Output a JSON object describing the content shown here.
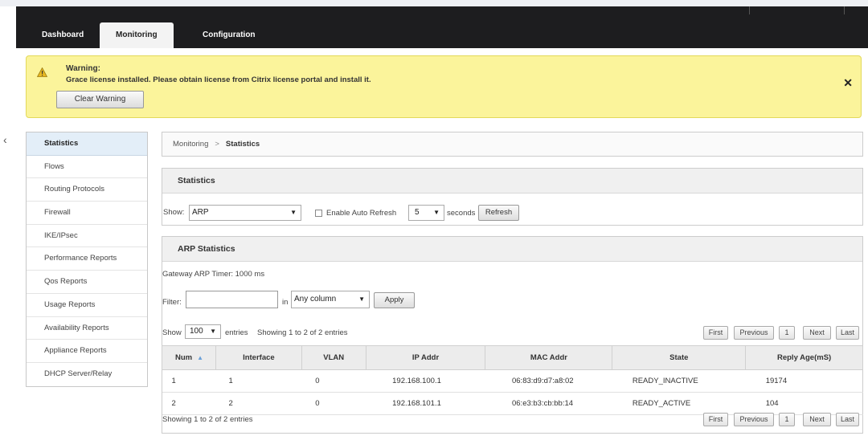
{
  "nav": {
    "tabs": [
      {
        "label": "Dashboard",
        "active": false
      },
      {
        "label": "Monitoring",
        "active": true
      },
      {
        "label": "Configuration",
        "active": false
      }
    ]
  },
  "warning": {
    "title": "Warning:",
    "message": "Grace license installed. Please obtain license from Citrix license portal and install it.",
    "clear_label": "Clear Warning",
    "close_glyph": "✕",
    "icon": "warning-triangle-icon",
    "background": "#fbf49b"
  },
  "collapse_glyph": "‹",
  "sidebar": {
    "items": [
      {
        "label": "Statistics",
        "active": true
      },
      {
        "label": "Flows",
        "active": false
      },
      {
        "label": "Routing Protocols",
        "active": false
      },
      {
        "label": "Firewall",
        "active": false
      },
      {
        "label": "IKE/IPsec",
        "active": false
      },
      {
        "label": "Performance Reports",
        "active": false
      },
      {
        "label": "Qos Reports",
        "active": false
      },
      {
        "label": "Usage Reports",
        "active": false
      },
      {
        "label": "Availability Reports",
        "active": false
      },
      {
        "label": "Appliance Reports",
        "active": false
      },
      {
        "label": "DHCP Server/Relay",
        "active": false
      }
    ]
  },
  "breadcrumb": {
    "parent": "Monitoring",
    "separator": ">",
    "current": "Statistics"
  },
  "statistics": {
    "title": "Statistics",
    "show_label": "Show:",
    "show_value": "ARP",
    "auto_refresh_label": "Enable Auto Refresh",
    "auto_refresh_checked": false,
    "interval_value": "5",
    "seconds_label": "seconds",
    "refresh_label": "Refresh"
  },
  "arp": {
    "title": "ARP Statistics",
    "timer_text": "Gateway ARP Timer: 1000 ms",
    "filter_label": "Filter:",
    "filter_value": "",
    "in_label": "in",
    "column_value": "Any column",
    "apply_label": "Apply",
    "show_label": "Show",
    "entries_value": "100",
    "entries_label": "entries",
    "showing_text": "Showing 1 to 2 of 2 entries",
    "pagination": {
      "first": "First",
      "previous": "Previous",
      "page": "1",
      "next": "Next",
      "last": "Last"
    },
    "columns": [
      "Num",
      "Interface",
      "VLAN",
      "IP Addr",
      "MAC Addr",
      "State",
      "Reply Age(mS)"
    ],
    "rows": [
      [
        "1",
        "1",
        "0",
        "192.168.100.1",
        "06:83:d9:d7:a8:02",
        "READY_INACTIVE",
        "19174"
      ],
      [
        "2",
        "2",
        "0",
        "192.168.101.1",
        "06:e3:b3:cb:bb:14",
        "READY_ACTIVE",
        "104"
      ]
    ],
    "footer_text": "Showing 1 to 2 of 2 entries"
  }
}
